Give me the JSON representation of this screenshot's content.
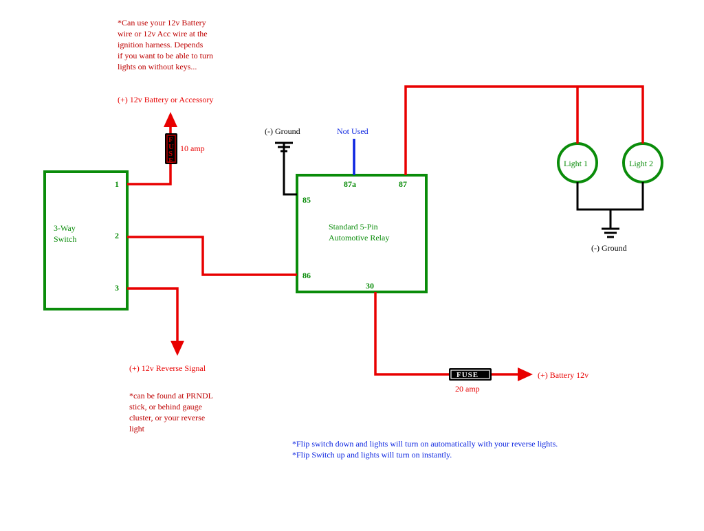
{
  "note_top": {
    "l1": "*Can use your 12v Battery",
    "l2": "wire or 12v Acc wire at the",
    "l3": "ignition harness. Depends",
    "l4": "if you want to be able to turn",
    "l5": "lights on without keys..."
  },
  "labels": {
    "batt_or_acc": "(+) 12v Battery or Accessory",
    "fuse10": "10 amp",
    "fuse20": "20 amp",
    "fuse_word": "FUSE",
    "switch_title_1": "3-Way",
    "switch_title_2": "Switch",
    "switch_pin1": "1",
    "switch_pin2": "2",
    "switch_pin3": "3",
    "relay_title_1": "Standard 5-Pin",
    "relay_title_2": "Automotive Relay",
    "relay_85": "85",
    "relay_86": "86",
    "relay_87a": "87a",
    "relay_87": "87",
    "relay_30": "30",
    "ground_minus_left": "(-) Ground",
    "ground_minus_right": "(-) Ground",
    "not_used": "Not Used",
    "light1": "Light 1",
    "light2": "Light 2",
    "batt_12v": "(+) Battery 12v",
    "reverse_signal": "(+) 12v Reverse Signal"
  },
  "note_rev": {
    "l1": "*can be found at PRNDL",
    "l2": "stick, or behind gauge",
    "l3": "cluster, or your reverse",
    "l4": "light"
  },
  "note_bottom": {
    "l1": "*Flip switch down and lights will turn on automatically with your reverse lights.",
    "l2": "*Flip Switch up and lights will turn on instantly."
  }
}
